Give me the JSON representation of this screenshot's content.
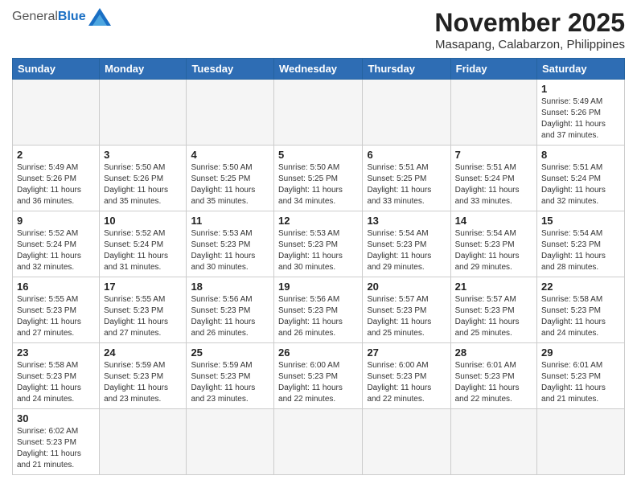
{
  "header": {
    "logo_general": "General",
    "logo_blue": "Blue",
    "month_year": "November 2025",
    "location": "Masapang, Calabarzon, Philippines"
  },
  "weekdays": [
    "Sunday",
    "Monday",
    "Tuesday",
    "Wednesday",
    "Thursday",
    "Friday",
    "Saturday"
  ],
  "weeks": [
    [
      {
        "day": "",
        "info": ""
      },
      {
        "day": "",
        "info": ""
      },
      {
        "day": "",
        "info": ""
      },
      {
        "day": "",
        "info": ""
      },
      {
        "day": "",
        "info": ""
      },
      {
        "day": "",
        "info": ""
      },
      {
        "day": "1",
        "info": "Sunrise: 5:49 AM\nSunset: 5:26 PM\nDaylight: 11 hours\nand 37 minutes."
      }
    ],
    [
      {
        "day": "2",
        "info": "Sunrise: 5:49 AM\nSunset: 5:26 PM\nDaylight: 11 hours\nand 36 minutes."
      },
      {
        "day": "3",
        "info": "Sunrise: 5:50 AM\nSunset: 5:26 PM\nDaylight: 11 hours\nand 35 minutes."
      },
      {
        "day": "4",
        "info": "Sunrise: 5:50 AM\nSunset: 5:25 PM\nDaylight: 11 hours\nand 35 minutes."
      },
      {
        "day": "5",
        "info": "Sunrise: 5:50 AM\nSunset: 5:25 PM\nDaylight: 11 hours\nand 34 minutes."
      },
      {
        "day": "6",
        "info": "Sunrise: 5:51 AM\nSunset: 5:25 PM\nDaylight: 11 hours\nand 33 minutes."
      },
      {
        "day": "7",
        "info": "Sunrise: 5:51 AM\nSunset: 5:24 PM\nDaylight: 11 hours\nand 33 minutes."
      },
      {
        "day": "8",
        "info": "Sunrise: 5:51 AM\nSunset: 5:24 PM\nDaylight: 11 hours\nand 32 minutes."
      }
    ],
    [
      {
        "day": "9",
        "info": "Sunrise: 5:52 AM\nSunset: 5:24 PM\nDaylight: 11 hours\nand 32 minutes."
      },
      {
        "day": "10",
        "info": "Sunrise: 5:52 AM\nSunset: 5:24 PM\nDaylight: 11 hours\nand 31 minutes."
      },
      {
        "day": "11",
        "info": "Sunrise: 5:53 AM\nSunset: 5:23 PM\nDaylight: 11 hours\nand 30 minutes."
      },
      {
        "day": "12",
        "info": "Sunrise: 5:53 AM\nSunset: 5:23 PM\nDaylight: 11 hours\nand 30 minutes."
      },
      {
        "day": "13",
        "info": "Sunrise: 5:54 AM\nSunset: 5:23 PM\nDaylight: 11 hours\nand 29 minutes."
      },
      {
        "day": "14",
        "info": "Sunrise: 5:54 AM\nSunset: 5:23 PM\nDaylight: 11 hours\nand 29 minutes."
      },
      {
        "day": "15",
        "info": "Sunrise: 5:54 AM\nSunset: 5:23 PM\nDaylight: 11 hours\nand 28 minutes."
      }
    ],
    [
      {
        "day": "16",
        "info": "Sunrise: 5:55 AM\nSunset: 5:23 PM\nDaylight: 11 hours\nand 27 minutes."
      },
      {
        "day": "17",
        "info": "Sunrise: 5:55 AM\nSunset: 5:23 PM\nDaylight: 11 hours\nand 27 minutes."
      },
      {
        "day": "18",
        "info": "Sunrise: 5:56 AM\nSunset: 5:23 PM\nDaylight: 11 hours\nand 26 minutes."
      },
      {
        "day": "19",
        "info": "Sunrise: 5:56 AM\nSunset: 5:23 PM\nDaylight: 11 hours\nand 26 minutes."
      },
      {
        "day": "20",
        "info": "Sunrise: 5:57 AM\nSunset: 5:23 PM\nDaylight: 11 hours\nand 25 minutes."
      },
      {
        "day": "21",
        "info": "Sunrise: 5:57 AM\nSunset: 5:23 PM\nDaylight: 11 hours\nand 25 minutes."
      },
      {
        "day": "22",
        "info": "Sunrise: 5:58 AM\nSunset: 5:23 PM\nDaylight: 11 hours\nand 24 minutes."
      }
    ],
    [
      {
        "day": "23",
        "info": "Sunrise: 5:58 AM\nSunset: 5:23 PM\nDaylight: 11 hours\nand 24 minutes."
      },
      {
        "day": "24",
        "info": "Sunrise: 5:59 AM\nSunset: 5:23 PM\nDaylight: 11 hours\nand 23 minutes."
      },
      {
        "day": "25",
        "info": "Sunrise: 5:59 AM\nSunset: 5:23 PM\nDaylight: 11 hours\nand 23 minutes."
      },
      {
        "day": "26",
        "info": "Sunrise: 6:00 AM\nSunset: 5:23 PM\nDaylight: 11 hours\nand 22 minutes."
      },
      {
        "day": "27",
        "info": "Sunrise: 6:00 AM\nSunset: 5:23 PM\nDaylight: 11 hours\nand 22 minutes."
      },
      {
        "day": "28",
        "info": "Sunrise: 6:01 AM\nSunset: 5:23 PM\nDaylight: 11 hours\nand 22 minutes."
      },
      {
        "day": "29",
        "info": "Sunrise: 6:01 AM\nSunset: 5:23 PM\nDaylight: 11 hours\nand 21 minutes."
      }
    ],
    [
      {
        "day": "30",
        "info": "Sunrise: 6:02 AM\nSunset: 5:23 PM\nDaylight: 11 hours\nand 21 minutes."
      },
      {
        "day": "",
        "info": ""
      },
      {
        "day": "",
        "info": ""
      },
      {
        "day": "",
        "info": ""
      },
      {
        "day": "",
        "info": ""
      },
      {
        "day": "",
        "info": ""
      },
      {
        "day": "",
        "info": ""
      }
    ]
  ]
}
